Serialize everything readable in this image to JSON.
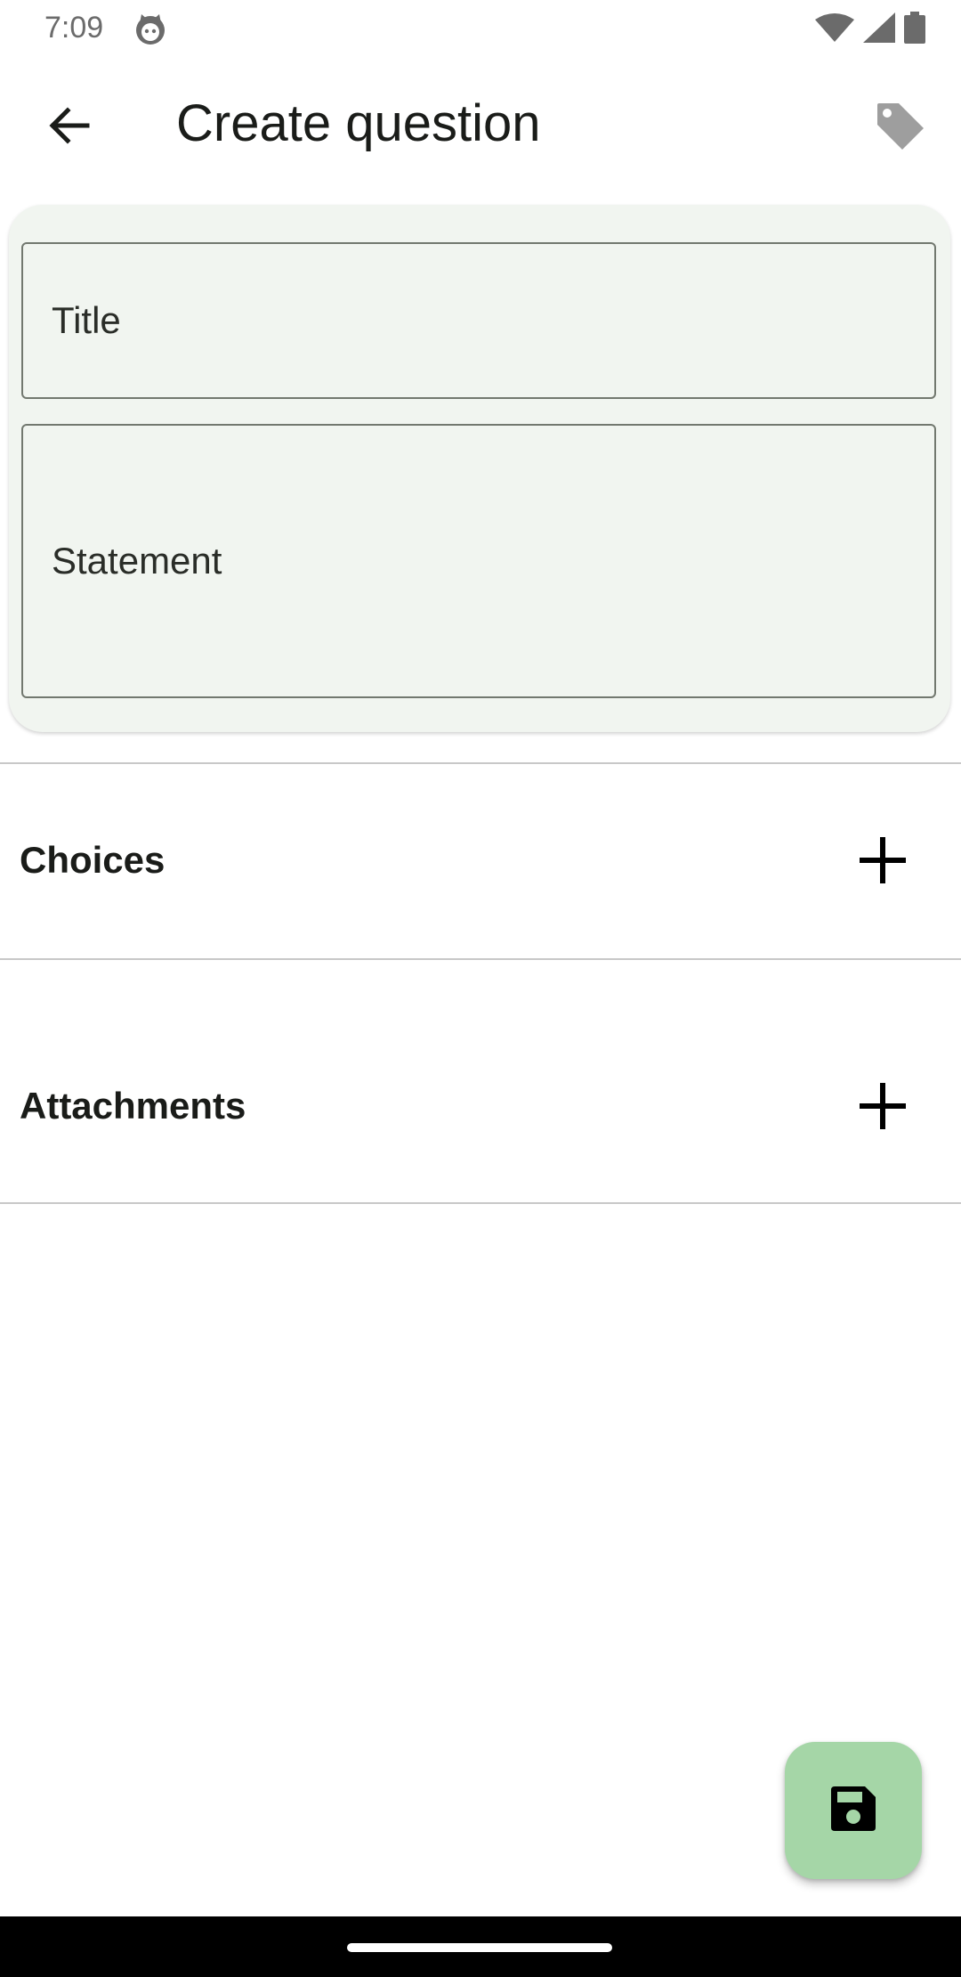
{
  "status_bar": {
    "time": "7:09",
    "icons": [
      "cat-notification-icon",
      "wifi-icon",
      "signal-icon",
      "battery-icon"
    ]
  },
  "app_bar": {
    "title": "Create question",
    "back_icon": "arrow-left-icon",
    "tag_icon": "tag-icon"
  },
  "form": {
    "title_placeholder": "Title",
    "statement_placeholder": "Statement"
  },
  "sections": {
    "choices_label": "Choices",
    "attachments_label": "Attachments",
    "add_icon": "plus-icon"
  },
  "fab": {
    "icon": "save-icon",
    "color": "#a5d6a7"
  },
  "colors": {
    "card_background": "#f1f5f0",
    "divider": "#c8c8c8",
    "tag_icon": "#9e9e9e"
  }
}
